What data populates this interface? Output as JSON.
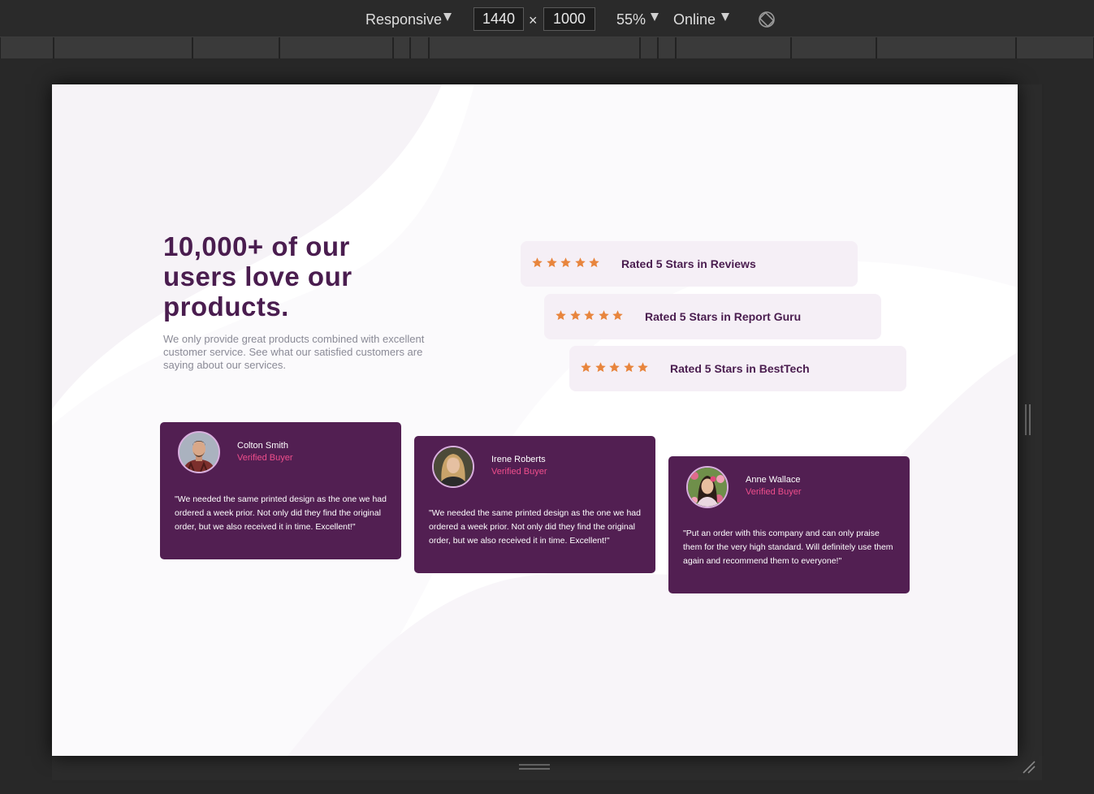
{
  "devtools": {
    "device_mode": "Responsive",
    "width": "1440",
    "height": "1000",
    "times": "×",
    "zoom": "55%",
    "network": "Online"
  },
  "page": {
    "headline": "10,000+ of our users love our products.",
    "subtext": "We only provide great products combined with excellent customer service. See what our satisfied customers are saying about our services.",
    "accent_color": "#4a1d4f",
    "star_color": "#e8853d",
    "card_color": "#521f52",
    "badge_color": "#ef4e8c",
    "ratings": [
      {
        "stars": 5,
        "label": "Rated 5 Stars in Reviews"
      },
      {
        "stars": 5,
        "label": "Rated 5 Stars in Report Guru"
      },
      {
        "stars": 5,
        "label": "Rated 5 Stars in BestTech"
      }
    ],
    "testimonials": [
      {
        "name": "Colton Smith",
        "status": "Verified Buyer",
        "quote": "\"We needed the same printed design as the one we had ordered a week prior. Not only did they find the original order, but we also received it in time. Excellent!\""
      },
      {
        "name": "Irene Roberts",
        "status": "Verified Buyer",
        "quote": "\"We needed the same printed design as the one we had ordered a week prior. Not only did they find the original order, but we also received it in time. Excellent!\""
      },
      {
        "name": "Anne Wallace",
        "status": "Verified Buyer",
        "quote": "\"Put an order with this company and can only praise them for the very high standard. Will definitely use them again and recommend them to everyone!\""
      }
    ]
  }
}
